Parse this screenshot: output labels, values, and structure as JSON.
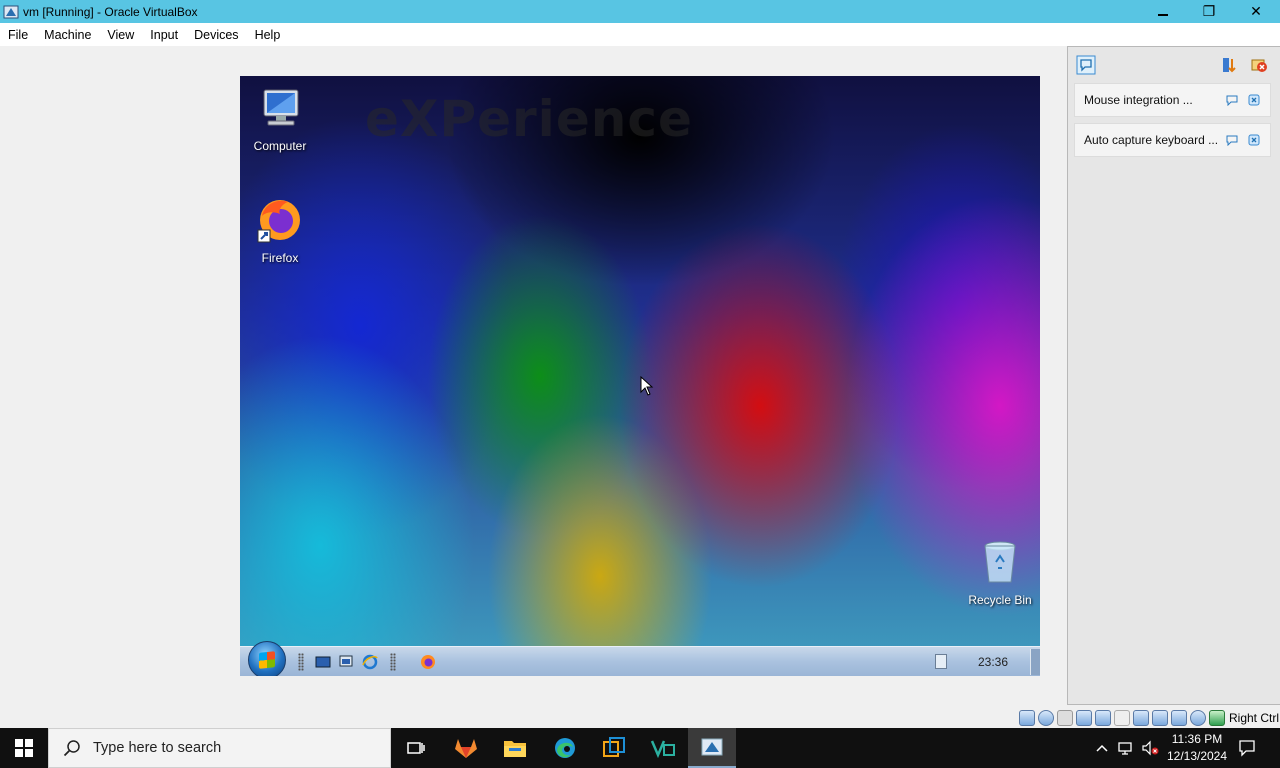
{
  "window": {
    "title": "vm [Running] - Oracle VirtualBox",
    "buttons": {
      "minimize": "",
      "restore": "❐",
      "close": "✕"
    }
  },
  "menubar": {
    "items": [
      "File",
      "Machine",
      "View",
      "Input",
      "Devices",
      "Help"
    ]
  },
  "guest": {
    "watermark": "eXPerience",
    "desktop_icons": {
      "computer": "Computer",
      "firefox": "Firefox",
      "recycle_bin": "Recycle Bin"
    },
    "taskbar": {
      "clock": "23:36"
    }
  },
  "notifications": {
    "cards": [
      {
        "text": "Mouse integration ..."
      },
      {
        "text": "Auto capture keyboard ..."
      }
    ]
  },
  "statusbar": {
    "host_key": "Right Ctrl",
    "icons": [
      "hard-disk-icon",
      "optical-drive-icon",
      "floppy-icon",
      "audio-icon",
      "network-icon",
      "usb-icon",
      "shared-folders-icon",
      "display-icon",
      "recording-icon",
      "cpu-icon",
      "capture-icon",
      "mouse-integration-icon",
      "keyboard-icon"
    ]
  },
  "host_taskbar": {
    "search_placeholder": "Type here to search",
    "apps": [
      "task-view-icon",
      "gitlab-icon",
      "file-explorer-icon",
      "edge-icon",
      "virtualbox-manager-icon",
      "vmware-icon",
      "virtualbox-vm-icon"
    ],
    "clock_time": "11:36 PM",
    "clock_date": "12/13/2024"
  }
}
